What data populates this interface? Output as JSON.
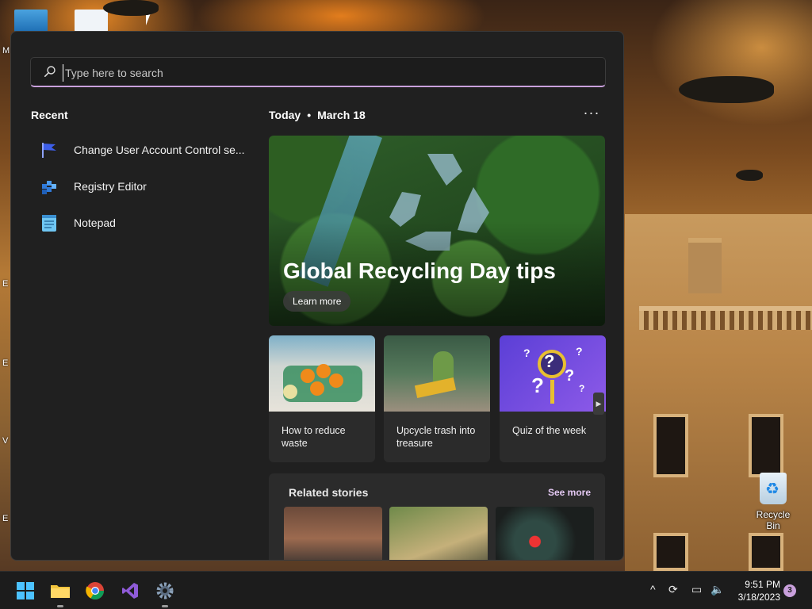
{
  "desktop": {
    "recycle_bin_label": "Recycle Bin",
    "edge_fragments": [
      "M",
      "E",
      "E",
      "V",
      "E"
    ]
  },
  "search": {
    "placeholder": "Type here to search"
  },
  "recent": {
    "title": "Recent",
    "items": [
      {
        "label": "Change User Account Control se...",
        "icon": "uac-flag-icon"
      },
      {
        "label": "Registry Editor",
        "icon": "registry-editor-icon"
      },
      {
        "label": "Notepad",
        "icon": "notepad-icon"
      }
    ]
  },
  "today": {
    "label": "Today",
    "separator": "•",
    "date": "March 18",
    "more_label": "···"
  },
  "hero": {
    "title": "Global Recycling Day tips",
    "button_label": "Learn more"
  },
  "cards": [
    {
      "caption": "How to reduce waste"
    },
    {
      "caption": "Upcycle trash into treasure"
    },
    {
      "caption": "Quiz of the week"
    }
  ],
  "related": {
    "title": "Related stories",
    "see_more": "See more"
  },
  "taskbar": {
    "apps": [
      "start-icon",
      "file-explorer-icon",
      "chrome-icon",
      "visual-studio-icon",
      "settings-icon"
    ],
    "time": "9:51 PM",
    "date": "3/18/2023",
    "notification_count": "3"
  },
  "colors": {
    "panel_bg": "#202020",
    "accent": "#c9a0dc",
    "card_bg": "#2b2b2b",
    "taskbar_bg": "#1c1c1c"
  }
}
